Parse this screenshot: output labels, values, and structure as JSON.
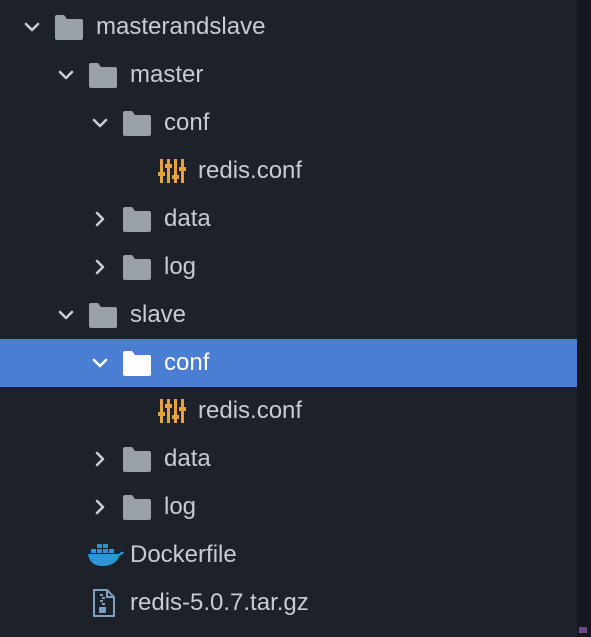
{
  "tree": {
    "root": {
      "label": "masterandslave",
      "expanded": true,
      "icon": "folder-icon"
    },
    "master": {
      "label": "master",
      "expanded": true,
      "icon": "folder-icon",
      "conf": {
        "label": "conf",
        "expanded": true,
        "file": "redis.conf",
        "file_icon": "settings-file-icon"
      },
      "data": {
        "label": "data",
        "expanded": false
      },
      "log": {
        "label": "log",
        "expanded": false
      }
    },
    "slave": {
      "label": "slave",
      "expanded": true,
      "icon": "folder-icon",
      "conf": {
        "label": "conf",
        "expanded": true,
        "selected": true,
        "file": "redis.conf",
        "file_icon": "settings-file-icon"
      },
      "data": {
        "label": "data",
        "expanded": false
      },
      "log": {
        "label": "log",
        "expanded": false
      }
    },
    "dockerfile": {
      "label": "Dockerfile",
      "icon": "docker-icon"
    },
    "archive": {
      "label": "redis-5.0.7.tar.gz",
      "icon": "archive-file-icon"
    }
  },
  "colors": {
    "background": "#1d2129",
    "selection": "#4a7ed2",
    "text": "#c7ccd4",
    "folder": "#9aa0a8",
    "config_icon": "#e8a33d",
    "docker_icon": "#2c95d6"
  }
}
